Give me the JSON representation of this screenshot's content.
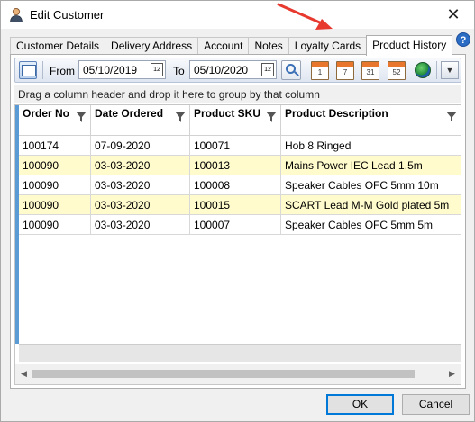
{
  "window": {
    "title": "Edit Customer",
    "close_glyph": "✕"
  },
  "tabs": [
    {
      "label": "Customer Details",
      "active": false
    },
    {
      "label": "Delivery Address",
      "active": false
    },
    {
      "label": "Account",
      "active": false
    },
    {
      "label": "Notes",
      "active": false
    },
    {
      "label": "Loyalty Cards",
      "active": false
    },
    {
      "label": "Product History",
      "active": true
    }
  ],
  "toolbar": {
    "from_label": "From",
    "from_value": "05/10/2019",
    "to_label": "To",
    "to_value": "05/10/2020",
    "quick_ranges": [
      "1",
      "7",
      "31",
      "52"
    ],
    "calendar_glyph": "12",
    "dropdown_glyph": "▼"
  },
  "group_panel": {
    "text": "Drag a column header and drop it here to group by that column"
  },
  "grid": {
    "columns": [
      "Order No",
      "Date Ordered",
      "Product SKU",
      "Product Description"
    ],
    "rows": [
      {
        "order_no": "100174",
        "date": "07-09-2020",
        "sku": "100071",
        "desc": "Hob 8 Ringed",
        "highlight": false
      },
      {
        "order_no": "100090",
        "date": "03-03-2020",
        "sku": "100013",
        "desc": "Mains Power IEC Lead 1.5m",
        "highlight": true
      },
      {
        "order_no": "100090",
        "date": "03-03-2020",
        "sku": "100008",
        "desc": "Speaker Cables OFC 5mm 10m",
        "highlight": false
      },
      {
        "order_no": "100090",
        "date": "03-03-2020",
        "sku": "100015",
        "desc": "SCART Lead M-M Gold plated 5m",
        "highlight": true
      },
      {
        "order_no": "100090",
        "date": "03-03-2020",
        "sku": "100007",
        "desc": "Speaker Cables OFC 5mm 5m",
        "highlight": false
      }
    ],
    "scroll_left": "◀",
    "scroll_right": "▶"
  },
  "buttons": {
    "ok": "OK",
    "cancel": "Cancel"
  },
  "help_glyph": "?",
  "colors": {
    "highlight_row": "#fffbcc",
    "row_indicator": "#5b9bd5",
    "annotation_arrow": "#e8392f",
    "default_button_border": "#0078d7"
  }
}
